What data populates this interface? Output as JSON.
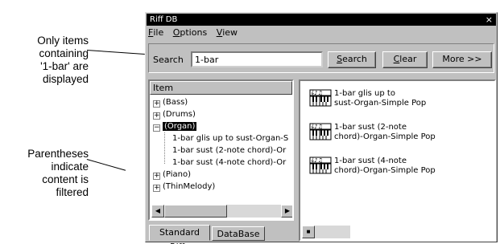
{
  "callouts": {
    "top": [
      "Only items",
      "containing",
      "'1-bar' are",
      "displayed"
    ],
    "bottom": [
      "Parentheses",
      "indicate",
      "content is",
      "filtered"
    ]
  },
  "window": {
    "title": "Riff DB",
    "close_glyph": "×"
  },
  "menu": [
    {
      "accel": "F",
      "rest": "ile"
    },
    {
      "accel": "O",
      "rest": "ptions"
    },
    {
      "accel": "V",
      "rest": "iew"
    }
  ],
  "search": {
    "label": "Search",
    "value": "1-bar",
    "buttons": [
      {
        "accel": "S",
        "rest": "earch"
      },
      {
        "accel": "C",
        "rest": "lear"
      },
      {
        "accel": "",
        "rest": "More >>"
      }
    ]
  },
  "tree": {
    "header": "Item",
    "rows": [
      {
        "pm": "+",
        "label": "(Bass)",
        "level": 0
      },
      {
        "pm": "+",
        "label": "(Drums)",
        "level": 0
      },
      {
        "pm": "−",
        "label": "(Organ)",
        "level": 0,
        "selected": true
      },
      {
        "pm": "",
        "label": "1-bar glis up to sust-Organ-S",
        "level": 1
      },
      {
        "pm": "",
        "label": "1-bar sust (2-note chord)-Or",
        "level": 1
      },
      {
        "pm": "",
        "label": "1-bar sust (4-note chord)-Or",
        "level": 1
      },
      {
        "pm": "+",
        "label": "(Piano)",
        "level": 0
      },
      {
        "pm": "+",
        "label": "(ThinMelody)",
        "level": 0
      }
    ]
  },
  "tabs": [
    "Standard Riffs",
    "DataBase"
  ],
  "riffs": [
    {
      "line1": "1-bar glis up to",
      "line2": "sust-Organ-Simple Pop",
      "icon": "organ-keyboard-icon"
    },
    {
      "line1": "1-bar sust (2-note",
      "line2": "chord)-Organ-Simple Pop",
      "icon": "organ-keyboard-icon"
    },
    {
      "line1": "1-bar sust (4-note",
      "line2": "chord)-Organ-Simple Pop",
      "icon": "organ-keyboard-icon"
    }
  ]
}
